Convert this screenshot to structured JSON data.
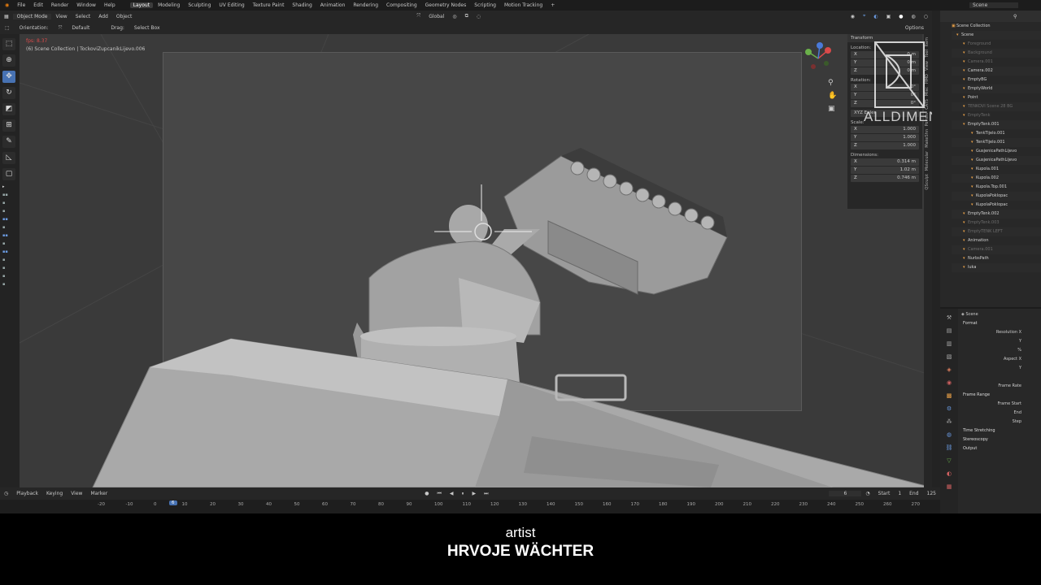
{
  "topbar": {
    "menus": [
      "File",
      "Edit",
      "Render",
      "Window",
      "Help"
    ],
    "workspaces": [
      "Layout",
      "Modeling",
      "Sculpting",
      "UV Editing",
      "Texture Paint",
      "Shading",
      "Animation",
      "Rendering",
      "Compositing",
      "Geometry Nodes",
      "Scripting",
      "Motion Tracking"
    ],
    "active_workspace": "Layout",
    "scene_label": "Scene"
  },
  "viewport_header": {
    "mode": "Object Mode",
    "menus": [
      "View",
      "Select",
      "Add",
      "Object"
    ],
    "transform_orientation": "Global",
    "options_label": "Options"
  },
  "tool_settings": {
    "orientation_label": "Orientation:",
    "orientation_value": "Default",
    "drag_label": "Drag:",
    "drag_value": "Select Box"
  },
  "viewport": {
    "frame_info": "fps: 8.37",
    "object_info": "(6) Scene Collection | TockoviZupcanikLijevo.006"
  },
  "npanel": {
    "tab": "Transform",
    "location_label": "Location:",
    "location": [
      {
        "axis": "X",
        "value": "0 m"
      },
      {
        "axis": "Y",
        "value": "0 m"
      },
      {
        "axis": "Z",
        "value": "0 m"
      }
    ],
    "rotation_label": "Rotation:",
    "rotation": [
      {
        "axis": "X",
        "value": "0°"
      },
      {
        "axis": "Y",
        "value": "0°"
      },
      {
        "axis": "Z",
        "value": "0°"
      }
    ],
    "rotation_mode": "XYZ Euler",
    "scale_label": "Scale:",
    "scale": [
      {
        "axis": "X",
        "value": "1.000"
      },
      {
        "axis": "Y",
        "value": "1.000"
      },
      {
        "axis": "Z",
        "value": "1.000"
      }
    ],
    "dimensions_label": "Dimensions:",
    "dimensions": [
      {
        "axis": "X",
        "value": "0.314 m"
      },
      {
        "axis": "Y",
        "value": "1.02 m"
      },
      {
        "axis": "Z",
        "value": "0.746 m"
      }
    ],
    "side_tabs": [
      "Item",
      "Tool",
      "View",
      "HMD",
      "Misc",
      "CATS",
      "Polntis",
      "MakeShn",
      "Molecular",
      "QSculpt"
    ]
  },
  "watermark": {
    "text": "ALLDIMENSIONS"
  },
  "outliner": {
    "header": "Scene Collection",
    "items": [
      {
        "label": "Scene",
        "dim": false
      },
      {
        "label": "Foreground",
        "dim": true
      },
      {
        "label": "Background",
        "dim": true
      },
      {
        "label": "Camera.001",
        "dim": true
      },
      {
        "label": "Camera.002",
        "dim": false
      },
      {
        "label": "EmptyBG",
        "dim": false
      },
      {
        "label": "EmptyWorld",
        "dim": false
      },
      {
        "label": "Point",
        "dim": false
      },
      {
        "label": "TENKOVI Scene 28 BG",
        "dim": true
      },
      {
        "label": "EmptyTenk",
        "dim": true
      },
      {
        "label": "EmptyTenk.001",
        "dim": false
      },
      {
        "label": "TenkTijelo.001",
        "dim": false
      },
      {
        "label": "TenkTijelo.001",
        "dim": false
      },
      {
        "label": "GusjenicaPathLijevo",
        "dim": false
      },
      {
        "label": "GusjenicaPathLijevo",
        "dim": false
      },
      {
        "label": "Kupola.001",
        "dim": false
      },
      {
        "label": "Kupola.002",
        "dim": false
      },
      {
        "label": "Kupola.Top.001",
        "dim": false
      },
      {
        "label": "KupolaPoklopac",
        "dim": false
      },
      {
        "label": "KupolaPoklopac",
        "dim": false
      },
      {
        "label": "EmptyTenk.002",
        "dim": false
      },
      {
        "label": "EmptyTenk.003",
        "dim": true
      },
      {
        "label": "EmptyTENK LEFT",
        "dim": true
      },
      {
        "label": "Animation",
        "dim": false
      },
      {
        "label": "Camera.001",
        "dim": true
      },
      {
        "label": "NurbsPath",
        "dim": false
      },
      {
        "label": "luka",
        "dim": false
      }
    ]
  },
  "properties": {
    "header": "Scene",
    "rows": [
      {
        "label": "Format",
        "type": "sec"
      },
      {
        "label": "Resolution X",
        "type": "r"
      },
      {
        "label": "Y",
        "type": "r"
      },
      {
        "label": "%",
        "type": "r"
      },
      {
        "label": "Aspect X",
        "type": "r"
      },
      {
        "label": "Y",
        "type": "r"
      },
      {
        "label": "",
        "type": "r"
      },
      {
        "label": "Frame Rate",
        "type": "r"
      },
      {
        "label": "Frame Range",
        "type": "sec"
      },
      {
        "label": "Frame Start",
        "type": "r"
      },
      {
        "label": "End",
        "type": "r"
      },
      {
        "label": "Step",
        "type": "r"
      },
      {
        "label": "Time Stretching",
        "type": "sec"
      },
      {
        "label": "Stereoscopy",
        "type": "sec"
      },
      {
        "label": "Output",
        "type": "sec"
      }
    ]
  },
  "timeline": {
    "menus": [
      "Playback",
      "Keying",
      "View",
      "Marker"
    ],
    "current_frame": "6",
    "start_label": "Start",
    "start_value": "1",
    "end_label": "End",
    "end_value": "125",
    "ticks": [
      "-20",
      "-10",
      "0",
      "10",
      "20",
      "30",
      "40",
      "50",
      "60",
      "70",
      "80",
      "90",
      "100",
      "110",
      "120",
      "130",
      "140",
      "150",
      "160",
      "170",
      "180",
      "190",
      "200",
      "210",
      "220",
      "230",
      "240",
      "250",
      "260",
      "270"
    ],
    "cursor_label": "6"
  },
  "subtitle": {
    "line1": "artist",
    "line2": "HRVOJE WÄCHTER"
  }
}
